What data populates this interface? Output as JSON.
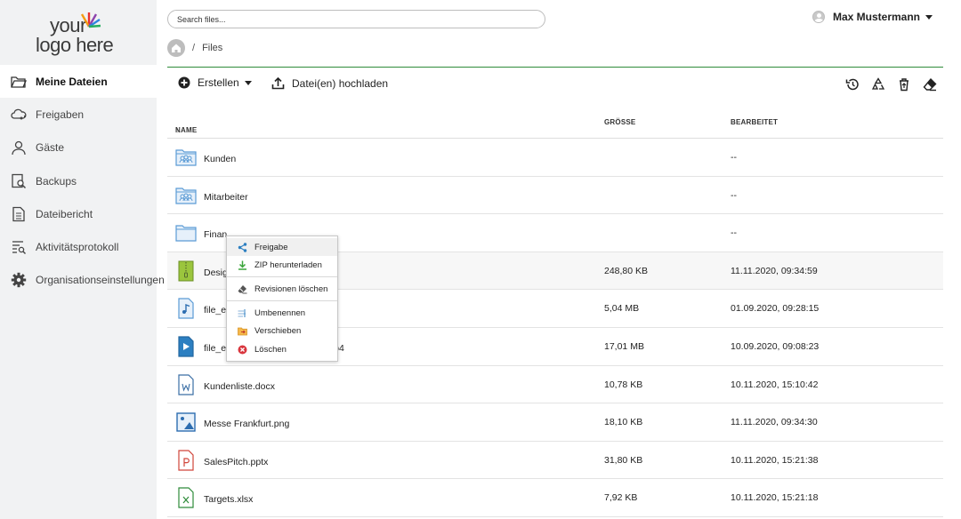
{
  "logo": {
    "line1": "your",
    "line2": "logo here"
  },
  "sidebar": {
    "items": [
      {
        "label": "Meine Dateien",
        "icon": "folder-open-icon",
        "active": true
      },
      {
        "label": "Freigaben",
        "icon": "cloud-share-icon",
        "active": false
      },
      {
        "label": "Gäste",
        "icon": "user-icon",
        "active": false
      },
      {
        "label": "Backups",
        "icon": "backup-search-icon",
        "active": false
      },
      {
        "label": "Dateibericht",
        "icon": "report-icon",
        "active": false
      },
      {
        "label": "Aktivitätsprotokoll",
        "icon": "activity-log-icon",
        "active": false
      },
      {
        "label": "Organisationseinstellungen",
        "icon": "gear-icon",
        "active": false
      }
    ]
  },
  "search": {
    "placeholder": "Search files..."
  },
  "user": {
    "name": "Max Mustermann"
  },
  "breadcrumb": {
    "separator": "/",
    "current": "Files"
  },
  "toolbar": {
    "create_label": "Erstellen",
    "upload_label": "Datei(en) hochladen",
    "right_icons": [
      "history-icon",
      "recycle-icon",
      "trash-restore-icon",
      "eraser-icon"
    ]
  },
  "table": {
    "headers": {
      "name": "NAME",
      "sort_arrow": "↑",
      "size": "GRÖSSE",
      "modified": "BEARBEITET"
    },
    "rows": [
      {
        "name": "Kunden",
        "size": "",
        "date": "--",
        "icon": "group-folder-icon"
      },
      {
        "name": "Mitarbeiter",
        "size": "",
        "date": "--",
        "icon": "group-folder-icon"
      },
      {
        "name": "Finan",
        "size": "",
        "date": "--",
        "icon": "folder-icon"
      },
      {
        "name": "Desig",
        "size": "248,80 KB",
        "date": "11.11.2020, 09:34:59",
        "icon": "zip-file-icon"
      },
      {
        "name": "file_e",
        "size": "5,04 MB",
        "date": "01.09.2020, 09:28:15",
        "icon": "audio-file-icon"
      },
      {
        "name": "file_e",
        "name_suffix": "p4",
        "size": "17,01 MB",
        "date": "10.09.2020, 09:08:23",
        "icon": "video-file-icon"
      },
      {
        "name": "Kundenliste.docx",
        "size": "10,78 KB",
        "date": "10.11.2020, 15:10:42",
        "icon": "word-file-icon"
      },
      {
        "name": "Messe Frankfurt.png",
        "size": "18,10 KB",
        "date": "11.11.2020, 09:34:30",
        "icon": "image-file-icon"
      },
      {
        "name": "SalesPitch.pptx",
        "size": "31,80 KB",
        "date": "10.11.2020, 15:21:38",
        "icon": "powerpoint-file-icon"
      },
      {
        "name": "Targets.xlsx",
        "size": "7,92 KB",
        "date": "10.11.2020, 15:21:18",
        "icon": "excel-file-icon"
      }
    ]
  },
  "context_menu": {
    "items": [
      {
        "label": "Freigabe",
        "icon": "share-icon"
      },
      {
        "label": "ZIP herunterladen",
        "icon": "download-icon"
      },
      {
        "label": "Revisionen löschen",
        "icon": "eraser-icon"
      },
      {
        "label": "Umbenennen",
        "icon": "rename-icon"
      },
      {
        "label": "Verschieben",
        "icon": "move-icon"
      },
      {
        "label": "Löschen",
        "icon": "delete-icon"
      }
    ]
  },
  "colors": {
    "accent_green": "#2e8b3a",
    "sidebar_bg": "#f1f2f3",
    "folder_blue": "#5b9bd5"
  }
}
